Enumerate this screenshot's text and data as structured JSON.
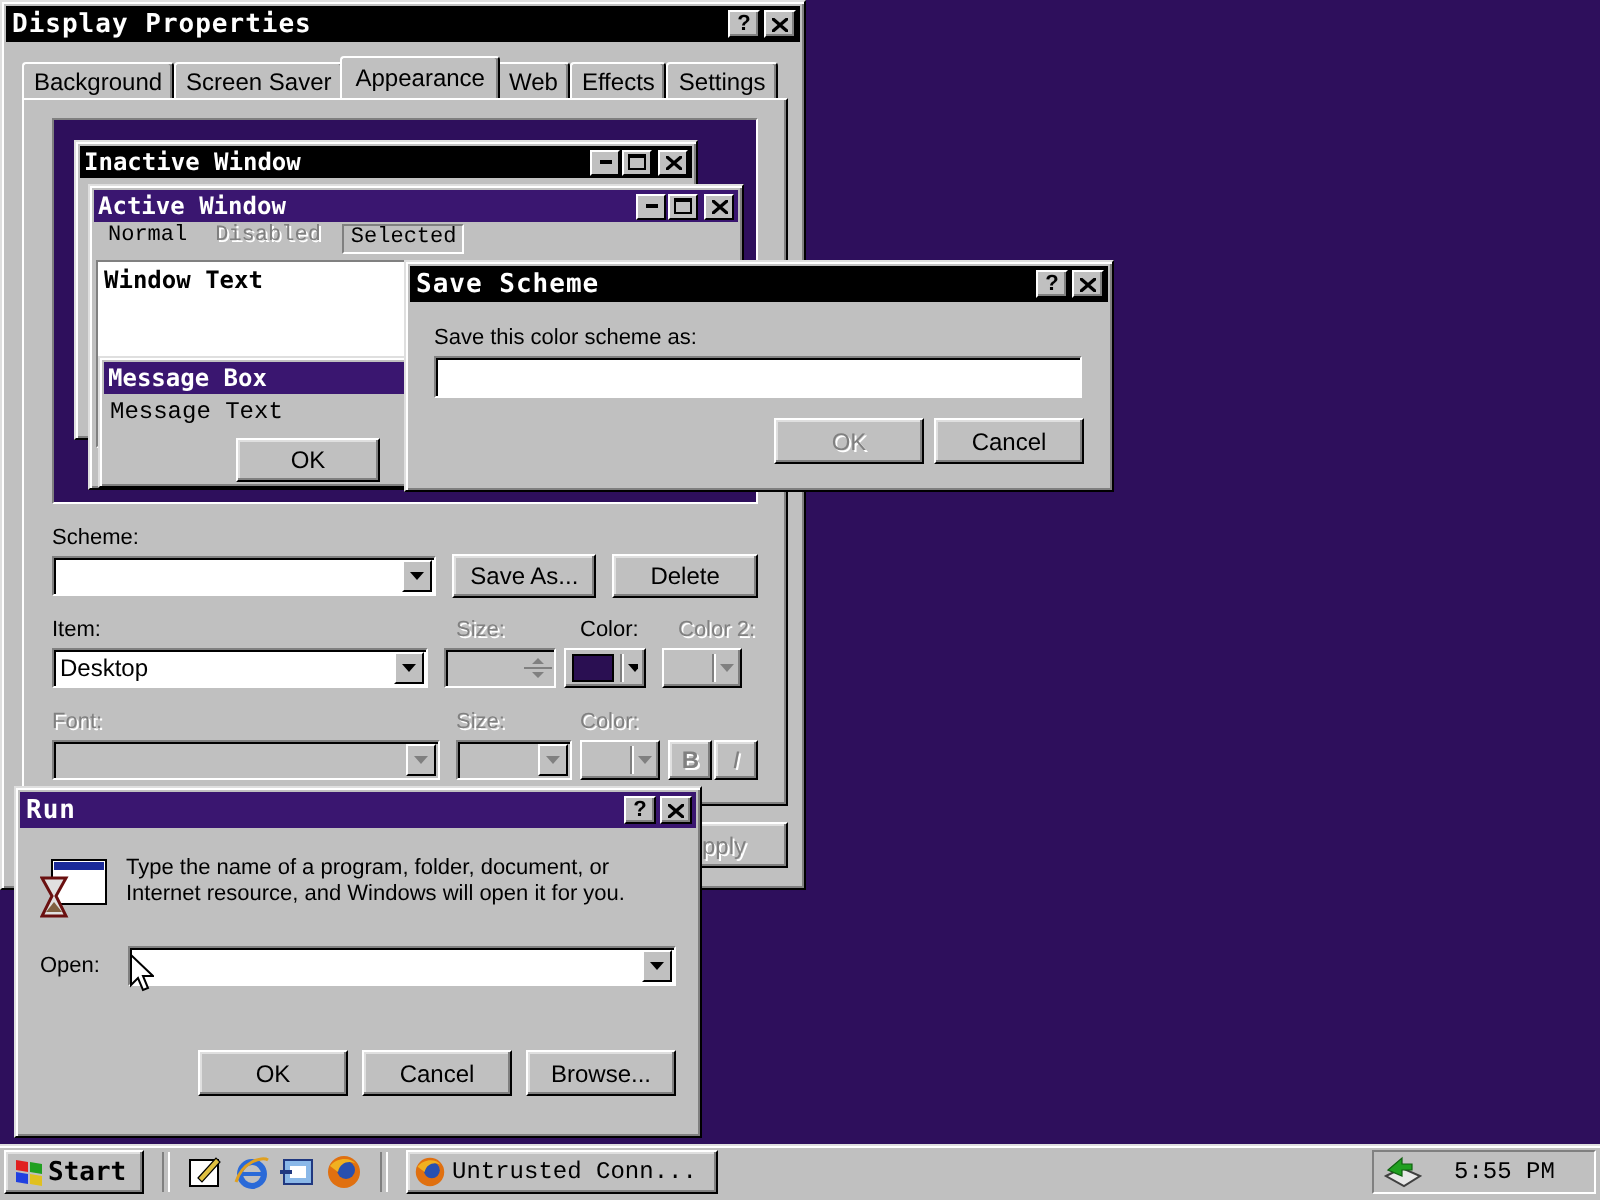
{
  "display_properties": {
    "title": "Display Properties",
    "help": "?",
    "tabs": [
      {
        "label": "Background",
        "selected": false
      },
      {
        "label": "Screen Saver",
        "selected": false
      },
      {
        "label": "Appearance",
        "selected": true
      },
      {
        "label": "Web",
        "selected": false
      },
      {
        "label": "Effects",
        "selected": false
      },
      {
        "label": "Settings",
        "selected": false
      }
    ],
    "preview": {
      "inactive_window": {
        "title": "Inactive Window"
      },
      "active_window": {
        "title": "Active Window",
        "menu": [
          {
            "label": "Normal",
            "kind": "normal"
          },
          {
            "label": "Disabled",
            "kind": "disabled"
          },
          {
            "label": "Selected",
            "kind": "selected"
          }
        ],
        "window_text": "Window Text"
      },
      "message_box": {
        "title": "Message Box",
        "text": "Message Text",
        "button": "OK"
      }
    },
    "scheme": {
      "label": "Scheme:",
      "save_as": "Save As...",
      "delete": "Delete"
    },
    "item": {
      "label": "Desktop",
      "caption": "Item:",
      "size": {
        "label": "Size:",
        "disabled": true
      },
      "color": {
        "label": "Color:",
        "disabled": false
      },
      "color2": {
        "label": "Color 2:",
        "disabled": true
      }
    },
    "font": {
      "caption": "Font:",
      "disabled": true,
      "size": {
        "label": "Size:",
        "disabled": true
      },
      "color": {
        "label": "Color:",
        "disabled": true
      },
      "bold": {
        "label": "B",
        "disabled": true
      },
      "italic": {
        "label": "I",
        "disabled": true
      }
    },
    "apply": {
      "label": "pply",
      "disabled": true
    }
  },
  "save_scheme": {
    "title": "Save Scheme",
    "help": "?",
    "prompt": "Save this color scheme as:",
    "buttons": [
      {
        "label": "OK",
        "disabled": true
      },
      {
        "label": "Cancel",
        "disabled": false
      }
    ]
  },
  "run": {
    "title": "Run",
    "help": "?",
    "description": "Type the name of a program, folder, document, or Internet resource, and Windows will open it for you.",
    "open_label": "Open:",
    "buttons": [
      {
        "label": "OK",
        "disabled": false
      },
      {
        "label": "Cancel",
        "disabled": false
      },
      {
        "label": "Browse...",
        "disabled": false
      }
    ]
  },
  "taskbar": {
    "start": "Start",
    "tasks": [
      {
        "label": "Untrusted Conn...",
        "selected": false
      }
    ],
    "clock": "5:55 PM"
  }
}
